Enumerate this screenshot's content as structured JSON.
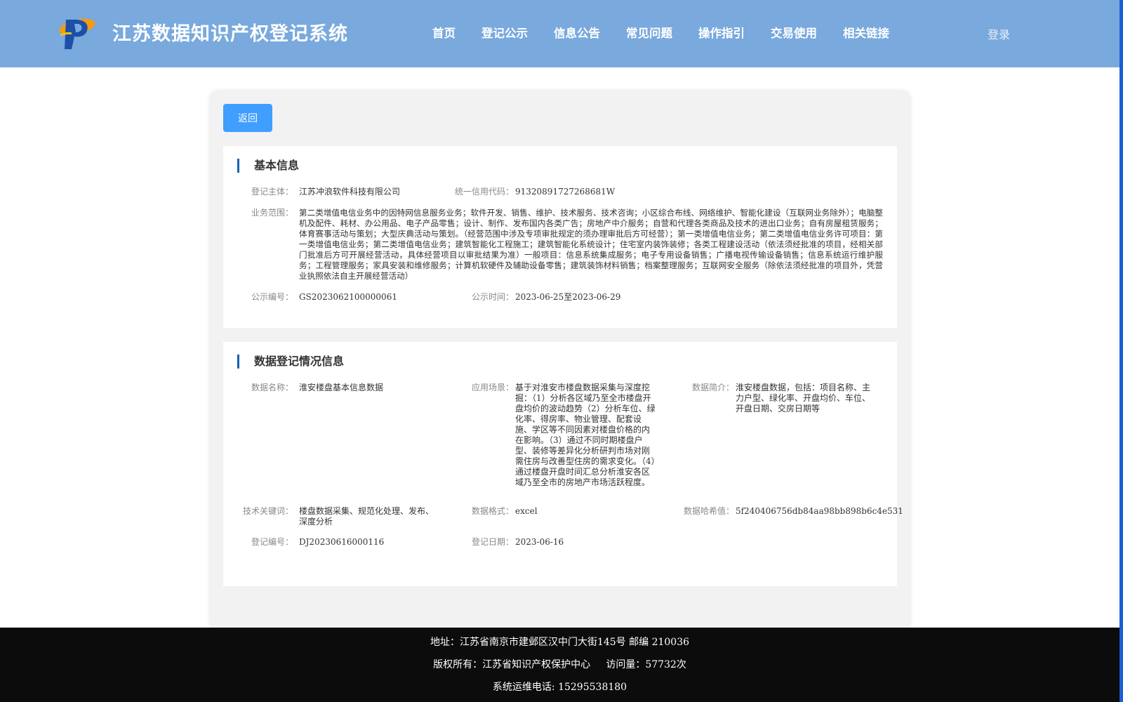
{
  "header": {
    "site_title": "江苏数据知识产权登记系统",
    "nav": [
      "首页",
      "登记公示",
      "信息公告",
      "常见问题",
      "操作指引",
      "交易使用",
      "相关链接"
    ],
    "login_label": "登录",
    "colors": {
      "header_bg": "#79a9dd",
      "accent": "#409eff"
    }
  },
  "back_label": "返回",
  "basic": {
    "title": "基本信息",
    "entity_label": "登记主体：",
    "entity_value": "江苏冲浪软件科技有限公司",
    "credit_label": "统一信用代码：",
    "credit_value": "91320891727268681W",
    "scope_label": "业务范围：",
    "scope_value": "第二类增值电信业务中的因特网信息服务业务；软件开发、销售、维护、技术服务、技术咨询；小区综合布线、网络维护、智能化建设（互联网业务除外）；电脑整机及配件、耗材、办公用品、电子产品零售；设计、制作、发布国内各类广告；房地产中介服务；自营和代理各类商品及技术的进出口业务；自有房屋租赁服务；体育赛事活动与策划；大型庆典活动与策划。（经营范围中涉及专项审批规定的须办理审批后方可经营）；第一类增值电信业务；第二类增值电信业务许可项目：第一类增值电信业务；第二类增值电信业务；建筑智能化工程施工；建筑智能化系统设计；住宅室内装饰装修；各类工程建设活动（依法须经批准的项目，经相关部门批准后方可开展经营活动，具体经营项目以审批结果为准）一般项目：信息系统集成服务；电子专用设备销售；广播电视传输设备销售；信息系统运行维护服务；工程管理服务；家具安装和维修服务；计算机软硬件及辅助设备零售；建筑装饰材料销售；档案整理服务；互联网安全服务（除依法须经批准的项目外，凭营业执照依法自主开展经营活动）",
    "pub_no_label": "公示编号：",
    "pub_no_value": "GS2023062100000061",
    "pub_time_label": "公示时间：",
    "pub_time_value": "2023-06-25至2023-06-29"
  },
  "data_reg": {
    "title": "数据登记情况信息",
    "name_label": "数据名称：",
    "name_value": "淮安楼盘基本信息数据",
    "scene_label": "应用场景：",
    "scene_value": "基于对淮安市楼盘数据采集与深度挖掘：（1）分析各区域乃至全市楼盘开盘均价的波动趋势（2）分析车位、绿化率、得房率、物业管理、配套设施、学区等不同因素对楼盘价格的内在影响。（3）通过不同时期楼盘户型、装修等差异化分析研判市场对刚需住房与改善型住房的需求变化。（4）通过楼盘开盘时间汇总分析淮安各区域乃至全市的房地产市场活跃程度。",
    "intro_label": "数据简介：",
    "intro_value": "淮安楼盘数据，包括：项目名称、主力户型、绿化率、开盘均价、车位、开盘日期、交房日期等",
    "keyword_label": "技术关键词：",
    "keyword_value": "楼盘数据采集、规范化处理、发布、深度分析",
    "format_label": "数据格式：",
    "format_value": "excel",
    "hash_label": "数据哈希值：",
    "hash_value": "5f240406756db84aa98bb898b6c4e531",
    "reg_no_label": "登记编号：",
    "reg_no_value": "DJ20230616000116",
    "reg_date_label": "登记日期：",
    "reg_date_value": "2023-06-16"
  },
  "footer": {
    "address": "地址：江苏省南京市建邺区汉中门大街145号 邮编 210036",
    "copyright": "版权所有：江苏省知识产权保护中心     访问量：57732次",
    "hotline": "系统运维电话: 15295538180"
  }
}
